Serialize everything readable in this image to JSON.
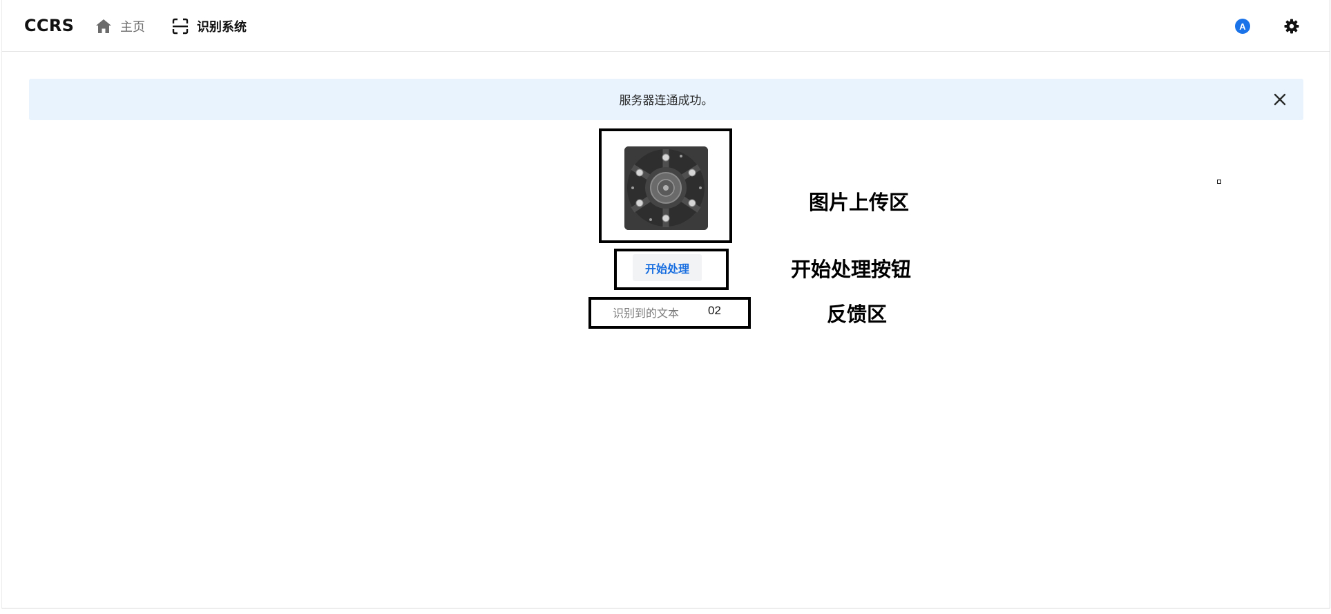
{
  "header": {
    "brand": "CCRS",
    "nav": [
      {
        "label": "主页",
        "icon": "home-icon"
      },
      {
        "label": "识别系统",
        "icon": "scan-icon"
      }
    ],
    "avatar_letter": "A",
    "accent_color": "#1a73e8"
  },
  "alert": {
    "message": "服务器连通成功。",
    "background": "#e8f3fd"
  },
  "upload": {
    "icon": "wheel-image"
  },
  "action": {
    "start_label": "开始处理"
  },
  "feedback": {
    "label": "识别到的文本",
    "value": "02"
  },
  "annotations": {
    "upload_area": "图片上传区",
    "start_button": "开始处理按钮",
    "feedback_area": "反馈区"
  }
}
